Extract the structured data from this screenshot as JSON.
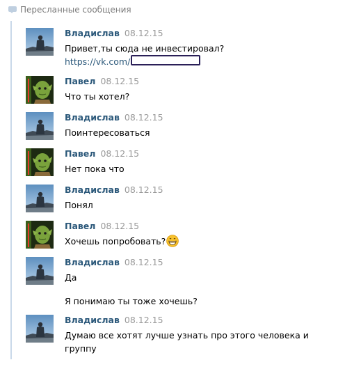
{
  "header": {
    "title": "Пересланные сообщения",
    "icon": "message-bubble-icon"
  },
  "messages": [
    {
      "author": "Владислав",
      "date": "08.12.15",
      "avatar": "vladislav-avatar",
      "lines": [
        "Привет,ты сюда не инвестировал?"
      ],
      "link": "https://vk.com/"
    },
    {
      "author": "Павел",
      "date": "08.12.15",
      "avatar": "pavel-avatar",
      "lines": [
        "Что ты хотел?"
      ]
    },
    {
      "author": "Владислав",
      "date": "08.12.15",
      "avatar": "vladislav-avatar",
      "lines": [
        "Поинтересоваться"
      ]
    },
    {
      "author": "Павел",
      "date": "08.12.15",
      "avatar": "pavel-avatar",
      "lines": [
        "Нет пока что"
      ]
    },
    {
      "author": "Владислав",
      "date": "08.12.15",
      "avatar": "vladislav-avatar",
      "lines": [
        "Понял"
      ]
    },
    {
      "author": "Павел",
      "date": "08.12.15",
      "avatar": "pavel-avatar",
      "lines": [
        "Хочешь попробовать?"
      ],
      "emoji": "grinning-face-emoji"
    },
    {
      "author": "Владислав",
      "date": "08.12.15",
      "avatar": "vladislav-avatar",
      "lines": [
        "Да"
      ],
      "continuation": "Я понимаю ты тоже хочешь?"
    },
    {
      "author": "Владислав",
      "date": "08.12.15",
      "avatar": "vladislav-avatar",
      "lines": [
        "Думаю все хотят лучше узнать про этого человека и",
        "группу"
      ]
    }
  ],
  "colors": {
    "author": "#2b587a",
    "date": "#999999",
    "header": "#7b7b7b",
    "forward_line": "#c9d9e9",
    "redaction_border": "#2a1f57"
  }
}
